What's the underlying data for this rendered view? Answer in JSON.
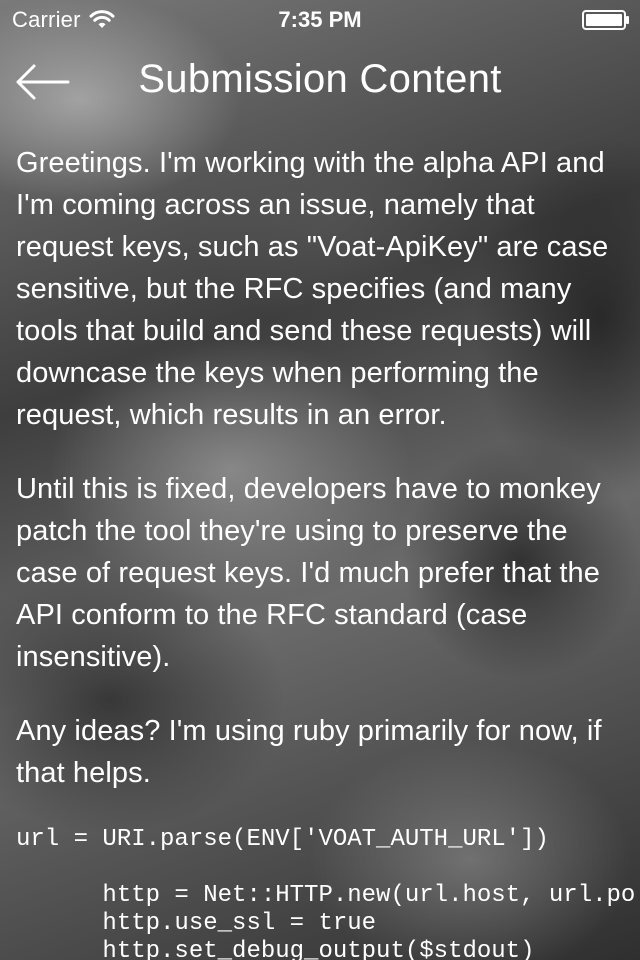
{
  "status_bar": {
    "carrier": "Carrier",
    "time": "7:35 PM",
    "icons": [
      "wifi-icon",
      "battery-icon"
    ]
  },
  "nav": {
    "title": "Submission Content",
    "back_icon": "arrow-left-icon"
  },
  "content": {
    "paragraphs": [
      "Greetings. I'm working with the alpha API and I'm coming across an issue, namely that request keys, such as \"Voat-ApiKey\" are case sensitive, but the RFC specifies (and many tools that build and send these requests) will downcase the keys when performing the request, which results in an error.",
      "Until this is fixed, developers have to monkey patch the tool they're using to preserve the case of request keys. I'd much prefer that the API conform to the RFC standard (case insensitive).",
      "Any ideas? I'm using ruby primarily for now, if that helps."
    ],
    "code": {
      "line1": "url = URI.parse(ENV['VOAT_AUTH_URL'])",
      "line2": "      http = Net::HTTP.new(url.host, url.port)",
      "line3": "      http.use_ssl = true",
      "line4": "      http.set_debug_output($stdout)"
    }
  },
  "colors": {
    "text": "#ffffff",
    "background": "#4a4a4a"
  }
}
